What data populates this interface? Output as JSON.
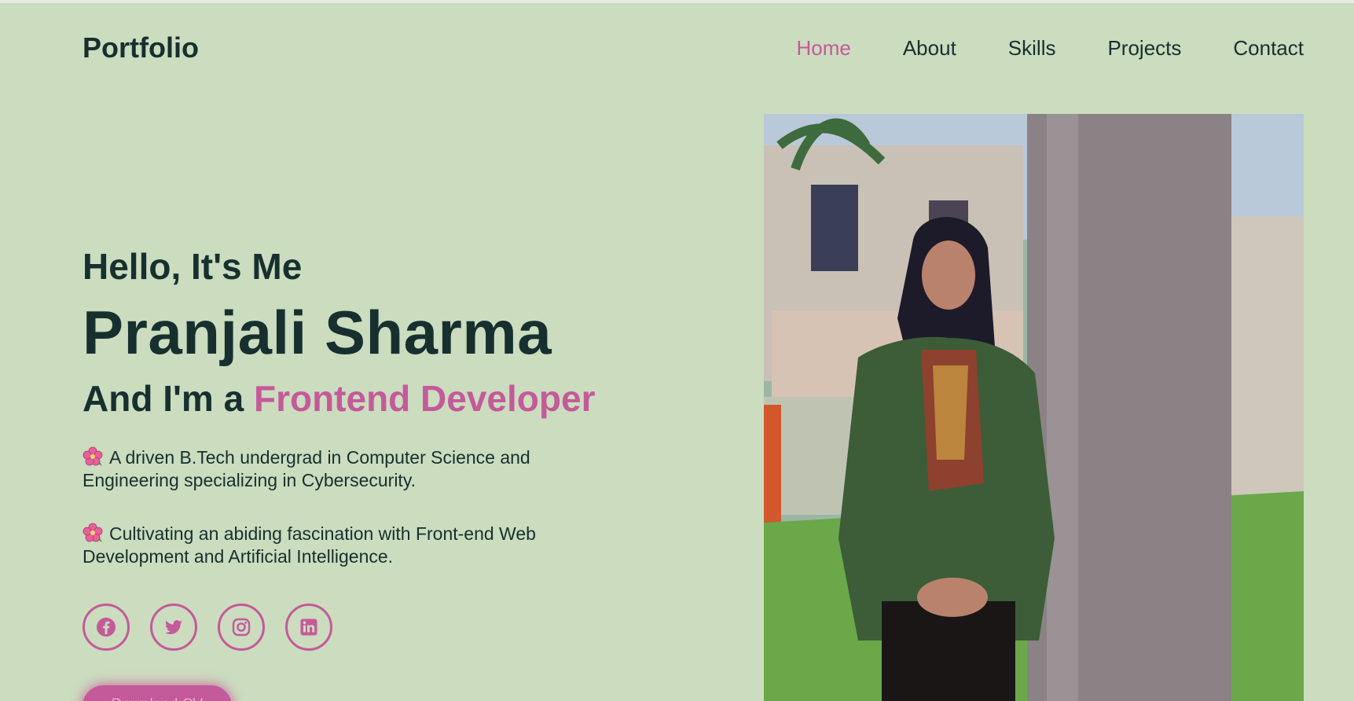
{
  "header": {
    "logo": "Portfolio",
    "nav": [
      "Home",
      "About",
      "Skills",
      "Projects",
      "Contact"
    ],
    "active": "Home"
  },
  "hero": {
    "greeting": "Hello, It's Me",
    "name": "Pranjali Sharma",
    "role_prefix": "And I'm a ",
    "role": "Frontend Developer",
    "paragraphs": [
      "A driven B.Tech undergrad in Computer Science and Engineering specializing in Cybersecurity.",
      "Cultivating an abiding fascination with Front-end Web Development and Artificial Intelligence."
    ],
    "socials": [
      "facebook-icon",
      "twitter-icon",
      "instagram-icon",
      "linkedin-icon"
    ],
    "cv_button": "Download CV"
  },
  "colors": {
    "background": "#cbdcbf",
    "text": "#17302f",
    "accent": "#c45a9a"
  }
}
